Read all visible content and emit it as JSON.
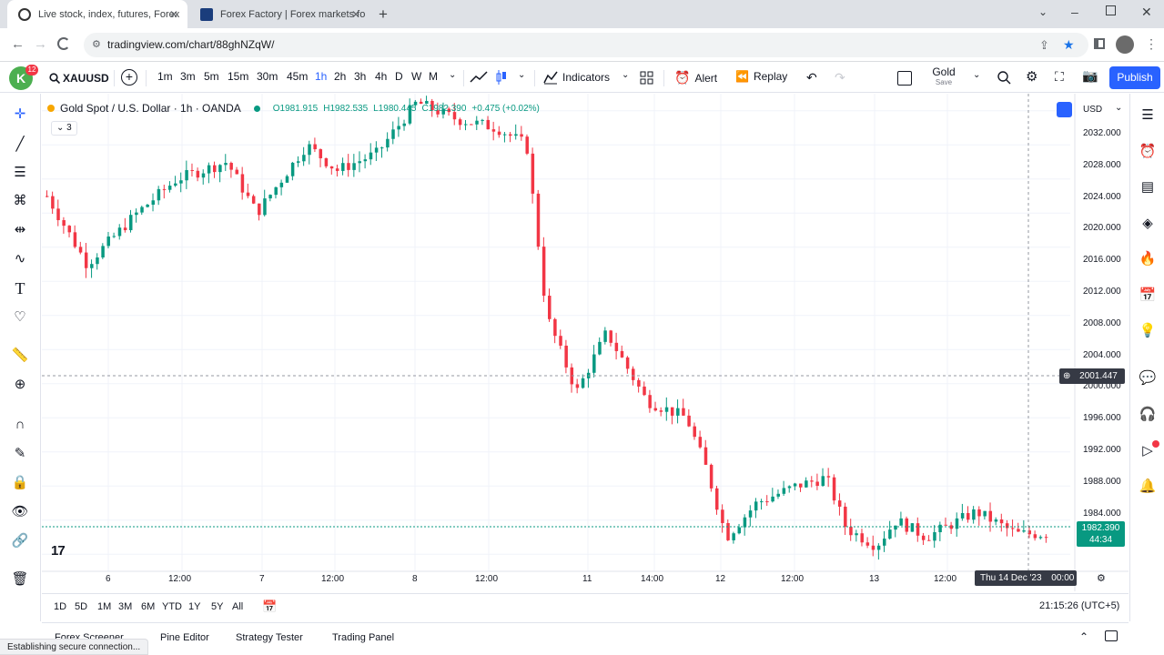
{
  "browser": {
    "tabs": [
      {
        "title": "Live stock, index, futures, Forex",
        "active": true
      },
      {
        "title": "Forex Factory | Forex markets fo",
        "active": false
      }
    ],
    "url": "tradingview.com/chart/88ghNZqW/",
    "status_text": "Establishing secure connection..."
  },
  "toolbar": {
    "avatar_letter": "K",
    "avatar_badge": "12",
    "symbol": "XAUUSD",
    "intervals": [
      "1m",
      "3m",
      "5m",
      "15m",
      "30m",
      "45m",
      "1h",
      "2h",
      "3h",
      "4h",
      "D",
      "W",
      "M"
    ],
    "active_interval": "1h",
    "indicators_label": "Indicators",
    "alert_label": "Alert",
    "replay_label": "Replay",
    "layout_name": "Gold",
    "layout_sub": "Save",
    "publish_label": "Publish"
  },
  "legend": {
    "title": "Gold Spot / U.S. Dollar · 1h · OANDA",
    "open": "O1981.915",
    "high": "H1982.535",
    "low": "L1980.445",
    "close": "C1982.390",
    "change": "+0.475 (+0.02%)",
    "collapsed_count": "3"
  },
  "price_axis": {
    "currency": "USD",
    "ticks": [
      "2032.000",
      "2028.000",
      "2024.000",
      "2020.000",
      "2016.000",
      "2012.000",
      "2008.000",
      "2004.000",
      "2000.000",
      "1996.000",
      "1992.000",
      "1988.000",
      "1984.000",
      "1980.000"
    ],
    "crosshair_price": "2001.447",
    "last_price": "1982.390",
    "countdown": "44:34"
  },
  "time_axis": {
    "ticks": [
      {
        "label": "6",
        "x": 119
      },
      {
        "label": "12:00",
        "x": 200
      },
      {
        "label": "7",
        "x": 288
      },
      {
        "label": "12:00",
        "x": 368
      },
      {
        "label": "8",
        "x": 456
      },
      {
        "label": "12:00",
        "x": 537
      },
      {
        "label": "11",
        "x": 646
      },
      {
        "label": "14:00",
        "x": 719
      },
      {
        "label": "12",
        "x": 792
      },
      {
        "label": "12:00",
        "x": 873
      },
      {
        "label": "13",
        "x": 961
      },
      {
        "label": "12:00",
        "x": 1041
      }
    ],
    "crosshair_time": "Thu 14 Dec '23",
    "crosshair_time_hm": "00:00"
  },
  "bottom": {
    "ranges": [
      "1D",
      "5D",
      "1M",
      "3M",
      "6M",
      "YTD",
      "1Y",
      "5Y",
      "All"
    ],
    "clock": "21:15:26 (UTC+5)",
    "panels": [
      "Forex Screener",
      "Pine Editor",
      "Strategy Tester",
      "Trading Panel"
    ]
  },
  "colors": {
    "up": "#089981",
    "down": "#f23645",
    "accent": "#2962ff",
    "grid": "#f0f3fa"
  },
  "chart_data": {
    "type": "candlestick",
    "symbol": "XAUUSD",
    "interval": "1h",
    "ylim": [
      1978,
      2034
    ],
    "close_path": [
      2022,
      2014,
      2020,
      2024,
      2026,
      2020,
      2028,
      2025,
      2027,
      2033,
      2031,
      2030,
      2028,
      2008,
      1999,
      2006,
      1998,
      1996,
      1990,
      1982,
      1986,
      1988,
      1989,
      1983,
      1981,
      1984,
      1982,
      1985,
      1982.39
    ],
    "close_x": [
      0.0,
      0.04,
      0.09,
      0.13,
      0.18,
      0.21,
      0.26,
      0.29,
      0.33,
      0.37,
      0.41,
      0.45,
      0.48,
      0.5,
      0.53,
      0.56,
      0.6,
      0.64,
      0.66,
      0.68,
      0.71,
      0.75,
      0.78,
      0.8,
      0.83,
      0.85,
      0.88,
      0.93,
      0.97
    ],
    "last_close": 1982.39
  }
}
